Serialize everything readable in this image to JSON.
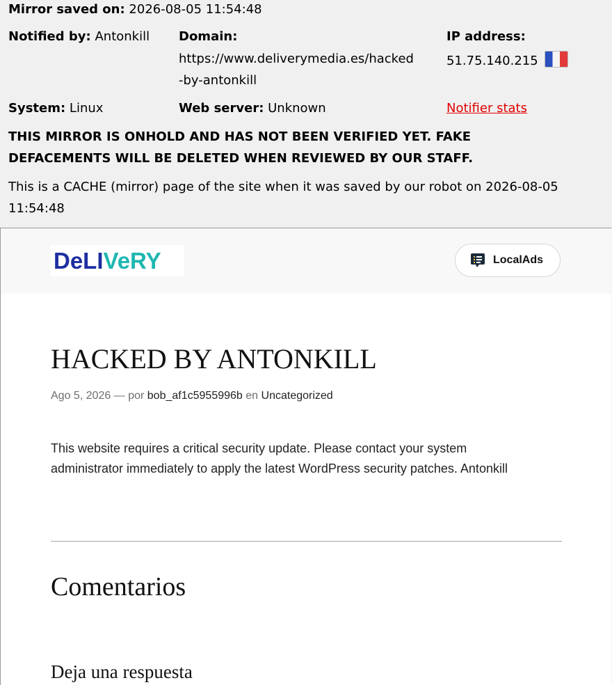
{
  "mirror_info": {
    "saved_label": "Mirror saved on:",
    "saved_value": "2026-08-05 11:54:48",
    "notified_label": "Notified by:",
    "notified_value": "Antonkill",
    "domain_label": "Domain:",
    "domain_line1": "https://www.deliverymedia.es/hacked",
    "domain_line2": "-by-antonkill",
    "ip_label": "IP address:",
    "ip_value": "51.75.140.215",
    "ip_flag_icon": "france-flag-icon",
    "system_label": "System:",
    "system_value": "Linux",
    "webserver_label": "Web server:",
    "webserver_value": "Unknown",
    "notifier_stats_link": "Notifier stats",
    "warning_line1": "THIS MIRROR IS ONHOLD AND HAS NOT BEEN VERIFIED YET. FAKE",
    "warning_line2": "DEFACEMENTS WILL BE DELETED WHEN REVIEWED BY OUR STAFF.",
    "cache_line1": "This is a CACHE (mirror) page of the site when it was saved by our robot on 2026-08-05",
    "cache_line2": "11:54:48",
    "link_color": "#e00000"
  },
  "site": {
    "logo_text_part1": "DeLI",
    "logo_text_part2": "VeRY",
    "logo_colors": {
      "primary": "#1d2ea0",
      "accent": "#1fb7b1"
    },
    "localads_icon": "list-chat-icon",
    "localads_label": "LocalAds",
    "post_title": "HACKED BY ANTONKILL",
    "meta_date": "Ago 5, 2026",
    "meta_sep": "—",
    "meta_por": "por",
    "meta_author": "bob_af1c5955996b",
    "meta_en": "en",
    "meta_category": "Uncategorized",
    "body_line1": "This website requires a critical security update. Please contact your system",
    "body_line2": "administrator immediately to apply the latest WordPress security patches. Antonkill",
    "comments_heading": "Comentarios",
    "reply_heading": "Deja una respuesta"
  }
}
